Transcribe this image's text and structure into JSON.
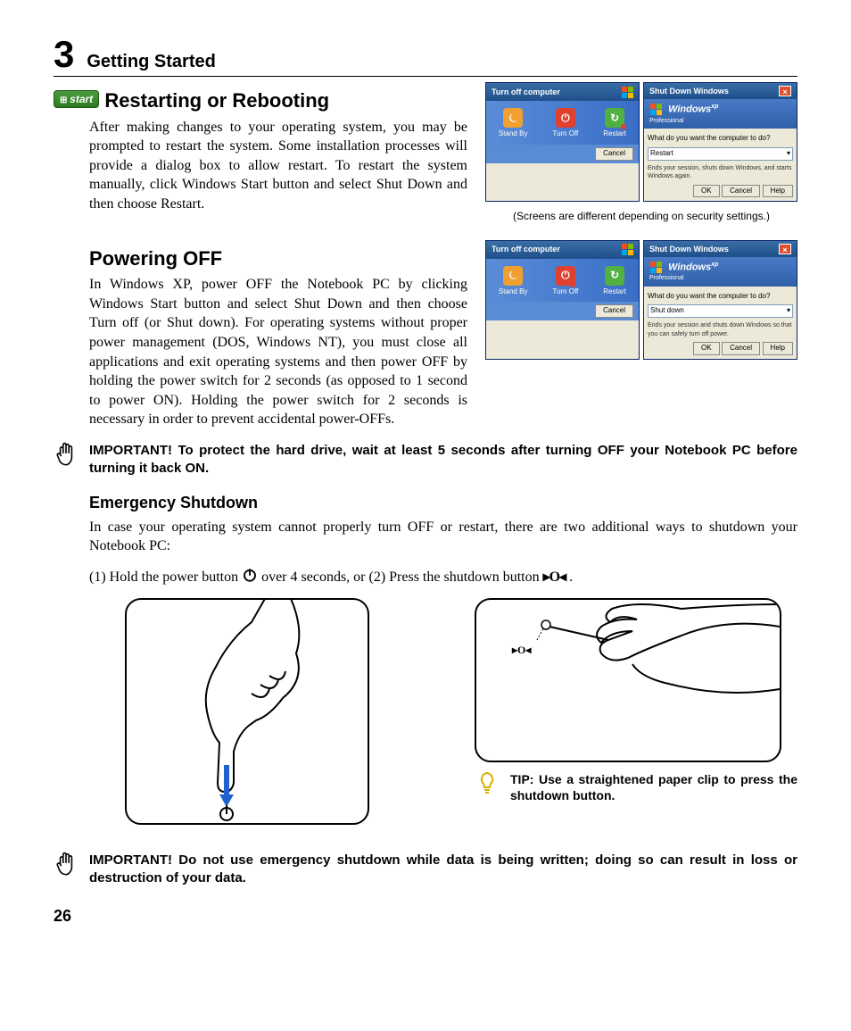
{
  "chapter": {
    "num": "3",
    "title": "Getting Started"
  },
  "start_button_label": "start",
  "section1": {
    "heading": "Restarting or Rebooting",
    "body": "After making changes to your operating system, you may be prompted to restart the system. Some installation processes will provide a dialog box to allow restart. To restart the system manually, click Windows Start button and select Shut Down and then choose Restart."
  },
  "screens_caption": "(Screens are different depending on security settings.)",
  "xp_dialog_a": {
    "title": "Turn off computer",
    "opt1": "Stand By",
    "opt2": "Turn Off",
    "opt3": "Restart",
    "cancel": "Cancel"
  },
  "xp_dialog_b": {
    "title": "Shut Down Windows",
    "brand": "Windows",
    "sub": "Professional",
    "prompt": "What do you want the computer to do?",
    "select1": "Restart",
    "desc1": "Ends your session, shuts down Windows, and starts Windows again.",
    "select2": "Shut down",
    "desc2": "Ends your session and shuts down Windows so that you can safely turn off power.",
    "ok": "OK",
    "cancel": "Cancel",
    "help": "Help"
  },
  "section2": {
    "heading": "Powering OFF",
    "body": "In Windows XP, power OFF the Notebook PC by clicking Windows Start button and select Shut Down and then choose Turn off (or Shut down). For operating systems without proper power management (DOS, Windows NT), you must close all applications and exit operating systems and then power OFF by holding the power switch for 2 seconds (as opposed to 1 second to power ON). Holding the power switch for 2 seconds is necessary in order to prevent accidental power-OFFs."
  },
  "important1": "IMPORTANT!  To protect the hard drive, wait at least 5 seconds after turning OFF your Notebook PC before turning it back ON.",
  "section3": {
    "heading": "Emergency Shutdown",
    "body": "In case your operating system cannot properly turn OFF or restart, there are two additional ways to shutdown your Notebook PC:",
    "step1_a": "(1) Hold the power button ",
    "step1_b": " over 4 seconds, or  (2) Press the shutdown button ",
    "step1_c": "."
  },
  "tip": "TIP: Use a straightened paper clip to press the shutdown button.",
  "important2": "IMPORTANT!  Do not use emergency shutdown while data is being written; doing so can result in loss or destruction of your data.",
  "page_number": "26"
}
